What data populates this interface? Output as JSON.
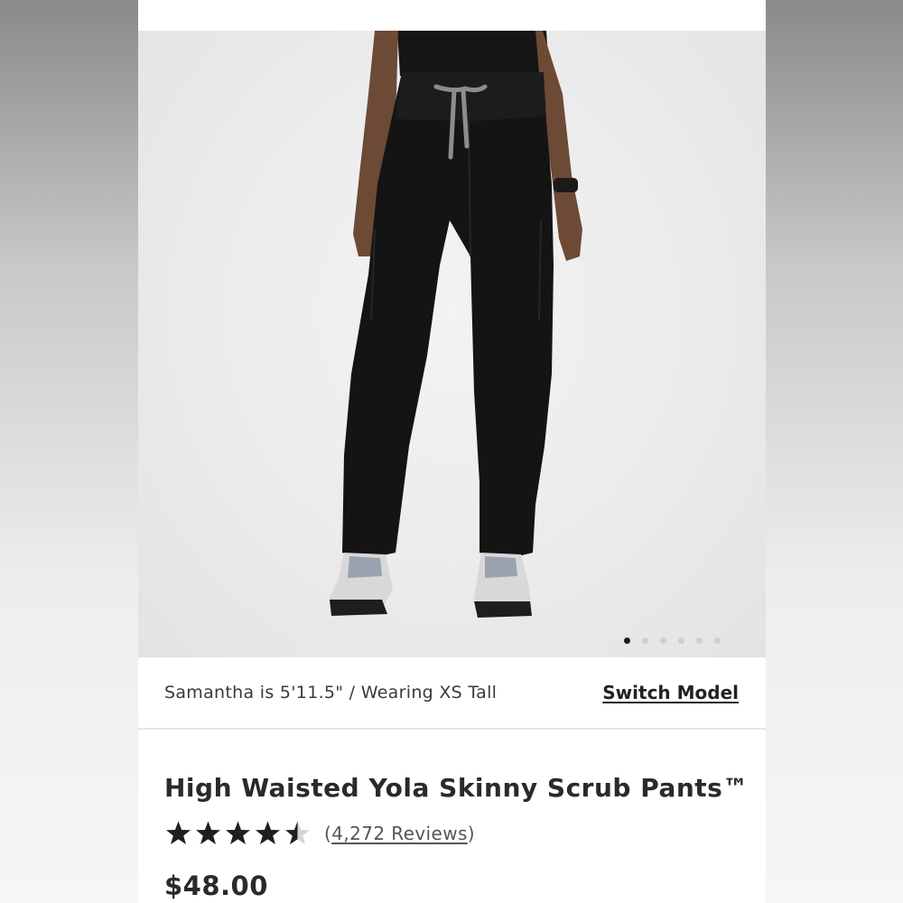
{
  "product": {
    "model_info": "Samantha is 5'11.5\" / Wearing XS Tall",
    "switch_model_label": "Switch Model",
    "title": "High Waisted Yola Skinny Scrub Pants™",
    "rating_value": 4.5,
    "rating_max": 5,
    "reviews_open": "(",
    "reviews_label": "4,272 Reviews",
    "reviews_close": ")",
    "price": "$48.00"
  },
  "gallery": {
    "image_count": 6,
    "active_index": 0
  },
  "colors": {
    "pants": "#141414",
    "drawstring": "#8d8d8d",
    "active_dot": "#1b1b1b",
    "inactive_dot": "#cfcfcf",
    "star_filled": "#1f1f1f",
    "star_empty": "#d4d4d4"
  }
}
